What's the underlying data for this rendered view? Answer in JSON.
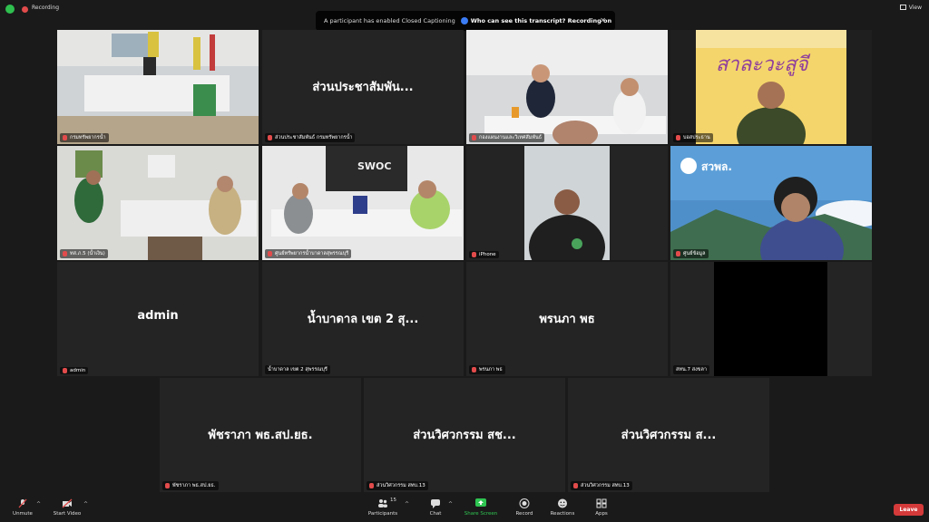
{
  "topbar": {
    "recording_label": "Recording",
    "view_label": "View"
  },
  "banner": {
    "message": "A participant has enabled Closed Captioning",
    "question": "Who can see this transcript? Recording on"
  },
  "tiles": [
    {
      "label": "กรมทรัพยากรน้ำ"
    },
    {
      "name": "ส่วนประชาสัมพัน...",
      "label": "ส่วนประชาสัมพันธ์ กรมทรัพยากรน้ำ"
    },
    {
      "label": "กองแผนงานและวิเทศสัมพันธ์"
    },
    {
      "label": "บอสประธาน"
    },
    {
      "label": "ทส.ภ.5 (น้ำเงิน)"
    },
    {
      "label": "ศูนย์ทรัพยากรน้ำบาดาลสุพรรณบุรี"
    },
    {
      "label": "iPhone"
    },
    {
      "label": "ศูนย์ข้อมูล"
    },
    {
      "name": "admin",
      "label": "admin"
    },
    {
      "name": "น้ำบาดาล เขต 2 สุ...",
      "label": "น้ำบาดาล เขต 2 สุพรรณบุรี"
    },
    {
      "name": "พรนภา พธ",
      "label": "พรนภา พธ"
    },
    {
      "label": "สทน.7 สงขลา"
    },
    {
      "name": "พัชราภา พธ.สป.ยธ.",
      "label": "พัชราภา พธ.สป.ยธ."
    },
    {
      "name": "ส่วนวิศวกรรม สช...",
      "label": "ส่วนวิศวกรรม สทบ.13"
    },
    {
      "name": "ส่วนวิศวกรรม ส...",
      "label": "ส่วนวิศวกรรม สทบ.13"
    }
  ],
  "poster": {
    "title_text": "สาละวะสูจี"
  },
  "scene_text": {
    "swoc": "SWOC",
    "dwr": "สวพล."
  },
  "toolbar": {
    "unmute": "Unmute",
    "start_video": "Start Video",
    "participants": "Participants",
    "participants_count": "15",
    "chat": "Chat",
    "share_screen": "Share Screen",
    "record": "Record",
    "reactions": "Reactions",
    "apps": "Apps",
    "leave": "Leave"
  },
  "colors": {
    "active_speaker": "#d7e23c",
    "share_green": "#2fc552",
    "leave_red": "#d43a3a",
    "mic_off": "#e24b4b"
  }
}
